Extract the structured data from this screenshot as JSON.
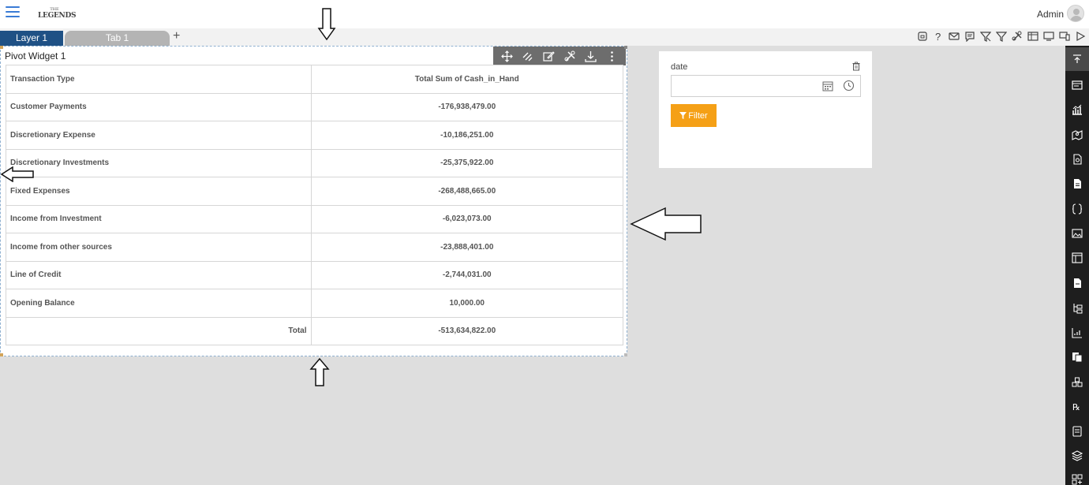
{
  "header": {
    "logo_top": "THE",
    "logo_main": "LEGENDS",
    "user_label": "Admin"
  },
  "tabs": {
    "layer_label": "Layer 1",
    "tab_label": "Tab 1",
    "add_label": "+"
  },
  "toolbar_icons": [
    "save-icon",
    "help-icon",
    "mail-icon",
    "comment-icon",
    "clear-filter-icon",
    "filter-icon",
    "settings-icon",
    "table-icon",
    "monitor-icon",
    "devices-icon",
    "play-icon"
  ],
  "sidebar_icons": [
    "collapse-icon",
    "widget-icon",
    "chart-icon",
    "map-icon",
    "pdf-icon",
    "document-icon",
    "code-icon",
    "image-icon",
    "frame-icon",
    "report-icon",
    "tree-icon",
    "trend-icon",
    "copy-icon",
    "group-icon",
    "formula-icon",
    "notes-icon",
    "layers-icon",
    "add-widget-icon"
  ],
  "pivot": {
    "title": "Pivot Widget 1",
    "col1_header": "Transaction Type",
    "col2_header": "Total Sum of Cash_in_Hand",
    "rows": [
      {
        "type": "Customer Payments",
        "value": "-176,938,479.00"
      },
      {
        "type": "Discretionary Expense",
        "value": "-10,186,251.00"
      },
      {
        "type": "Discretionary Investments",
        "value": "-25,375,922.00"
      },
      {
        "type": "Fixed Expenses",
        "value": "-268,488,665.00"
      },
      {
        "type": "Income from Investment",
        "value": "-6,023,073.00"
      },
      {
        "type": "Income from other sources",
        "value": "-23,888,401.00"
      },
      {
        "type": "Line of Credit",
        "value": "-2,744,031.00"
      },
      {
        "type": "Opening Balance",
        "value": "10,000.00"
      }
    ],
    "total_label": "Total",
    "total_value": "-513,634,822.00"
  },
  "filter": {
    "label": "date",
    "input_value": "",
    "input_placeholder": "",
    "button_label": "Filter",
    "accent_color": "#f5a016"
  },
  "colors": {
    "layer_tab": "#1f5185",
    "sidebar_bg": "#1e1e1e",
    "canvas_bg": "#dedede"
  }
}
